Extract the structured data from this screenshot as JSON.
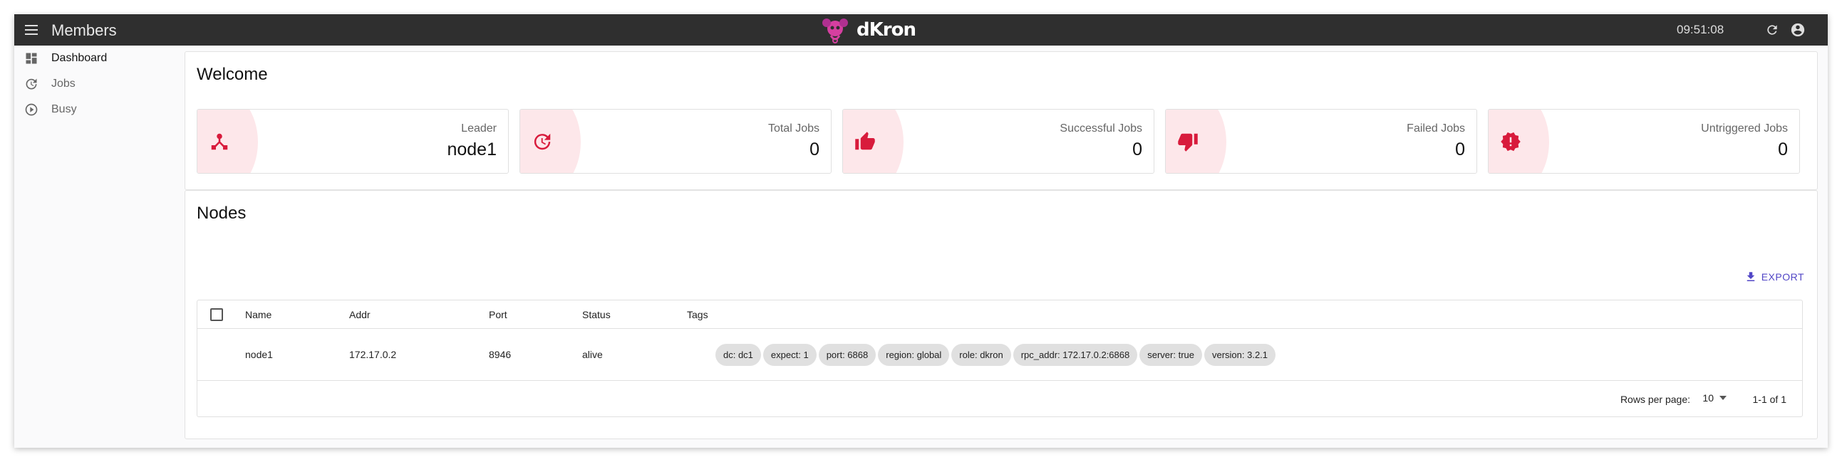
{
  "appbar": {
    "title": "Members",
    "logo_text": "dKron",
    "clock": "09:51:08",
    "refresh_icon": "refresh-icon",
    "account_icon": "account-circle-icon",
    "menu_icon": "menu-icon"
  },
  "sidebar": {
    "items": [
      {
        "label": "Dashboard",
        "icon": "dashboard-icon",
        "active": true
      },
      {
        "label": "Jobs",
        "icon": "update-icon",
        "active": false
      },
      {
        "label": "Busy",
        "icon": "play-circle-icon",
        "active": false
      }
    ]
  },
  "welcome": {
    "title": "Welcome",
    "stats": [
      {
        "label": "Leader",
        "value": "node1",
        "icon": "device-hub-icon"
      },
      {
        "label": "Total Jobs",
        "value": "0",
        "icon": "update-icon"
      },
      {
        "label": "Successful Jobs",
        "value": "0",
        "icon": "thumb-up-icon"
      },
      {
        "label": "Failed Jobs",
        "value": "0",
        "icon": "thumb-down-icon"
      },
      {
        "label": "Untriggered Jobs",
        "value": "0",
        "icon": "new-releases-icon"
      }
    ]
  },
  "nodes": {
    "title": "Nodes",
    "export_label": "EXPORT",
    "columns": [
      "Name",
      "Addr",
      "Port",
      "Status",
      "Tags"
    ],
    "rows": [
      {
        "name": "node1",
        "addr": "172.17.0.2",
        "port": "8946",
        "status": "alive",
        "tags": [
          "dc: dc1",
          "expect: 1",
          "port: 6868",
          "region: global",
          "role: dkron",
          "rpc_addr: 172.17.0.2:6868",
          "server: true",
          "version: 3.2.1"
        ]
      }
    ],
    "footer": {
      "rows_per_page_label": "Rows per page:",
      "rows_per_page_value": "10",
      "range": "1-1 of 1"
    }
  },
  "colors": {
    "appbar": "#2f2f2f",
    "accent": "#d81b3c",
    "stat_blob": "#fde7ea",
    "export": "#5146c6",
    "logo_pink": "#d63fa0"
  }
}
